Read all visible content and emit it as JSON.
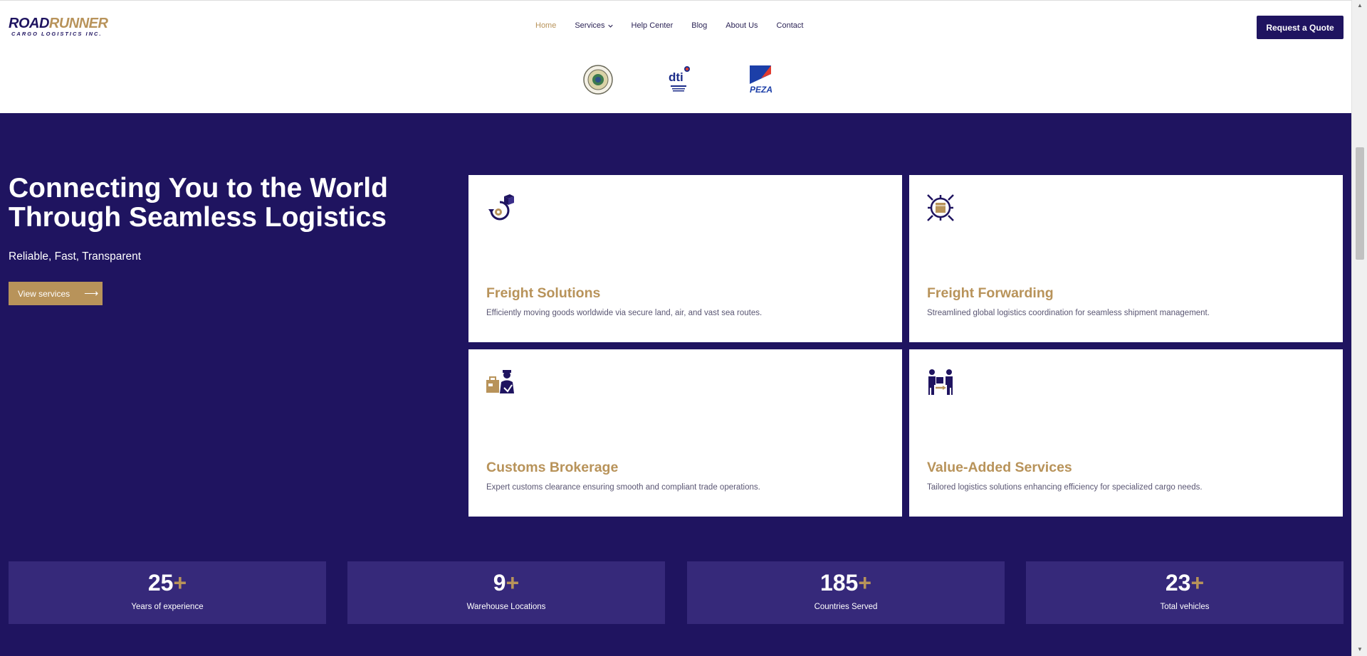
{
  "header": {
    "logo": {
      "word1": "ROAD",
      "word2": "RUNNER",
      "tagline": "CARGO LOGISTICS INC."
    },
    "nav": [
      {
        "label": "Home",
        "active": true
      },
      {
        "label": "Services",
        "dropdown": true
      },
      {
        "label": "Help Center"
      },
      {
        "label": "Blog"
      },
      {
        "label": "About Us"
      },
      {
        "label": "Contact"
      }
    ],
    "cta_label": "Request a Quote"
  },
  "badges": [
    {
      "name": "seal-badge",
      "text": ""
    },
    {
      "name": "dti-badge",
      "text": "dti"
    },
    {
      "name": "peza-badge",
      "text": "PEZA"
    }
  ],
  "hero": {
    "title_line1": "Connecting You to the World",
    "title_line2": "Through Seamless Logistics",
    "subtitle": "Reliable, Fast, Transparent",
    "button_label": "View services",
    "button_arrow": "⟶"
  },
  "services": [
    {
      "title": "Freight Solutions",
      "desc": "Efficiently moving goods worldwide via secure land, air, and vast sea routes.",
      "icon": "freight-cycle-icon"
    },
    {
      "title": "Freight Forwarding",
      "desc": "Streamlined global logistics coordination for seamless shipment management.",
      "icon": "forwarding-hub-icon"
    },
    {
      "title": "Customs Brokerage",
      "desc": "Expert customs clearance ensuring smooth and compliant trade operations.",
      "icon": "customs-officer-icon"
    },
    {
      "title": "Value-Added Services",
      "desc": "Tailored logistics solutions enhancing efficiency for specialized cargo needs.",
      "icon": "handover-icon"
    }
  ],
  "stats": [
    {
      "value": "25",
      "suffix": "+",
      "label": "Years of experience"
    },
    {
      "value": "9",
      "suffix": "+",
      "label": "Warehouse Locations"
    },
    {
      "value": "185",
      "suffix": "+",
      "label": "Countries Served"
    },
    {
      "value": "23",
      "suffix": "+",
      "label": "Total vehicles"
    }
  ],
  "colors": {
    "navy": "#1f1460",
    "gold": "#b8935a",
    "stat_bg": "#36297a"
  }
}
